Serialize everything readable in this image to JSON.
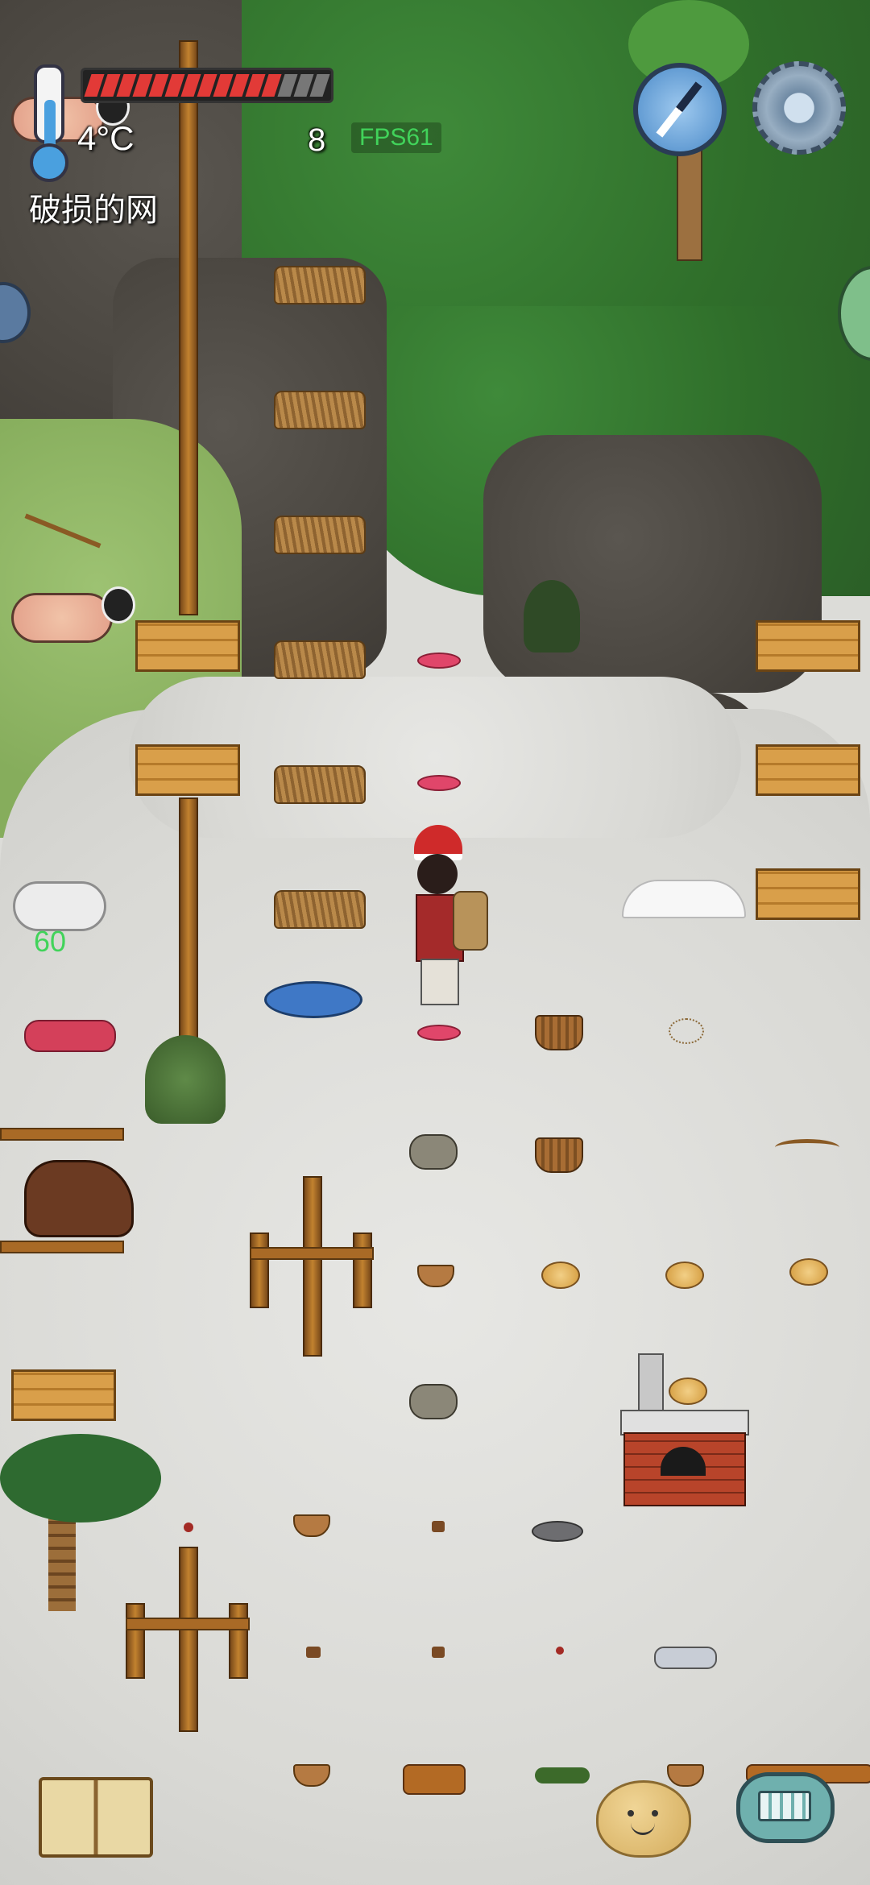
{
  "hud": {
    "temperature": "4°C",
    "item_name": "破损的网",
    "food_count": "8",
    "fps": "FPS61",
    "health_segments": {
      "filled": 12,
      "total": 15
    }
  },
  "world": {
    "item_count": "60"
  },
  "icons": {
    "thermometer": "thermometer-icon",
    "compass": "compass-icon",
    "settings": "gear-icon",
    "journal": "open-book-icon",
    "emote": "smiley-potato-icon",
    "keyboard": "keyboard-chat-icon"
  },
  "colors": {
    "health": "#e23a37",
    "health_empty": "#777777",
    "fps": "#41d35a",
    "item_count": "#41d35a"
  }
}
